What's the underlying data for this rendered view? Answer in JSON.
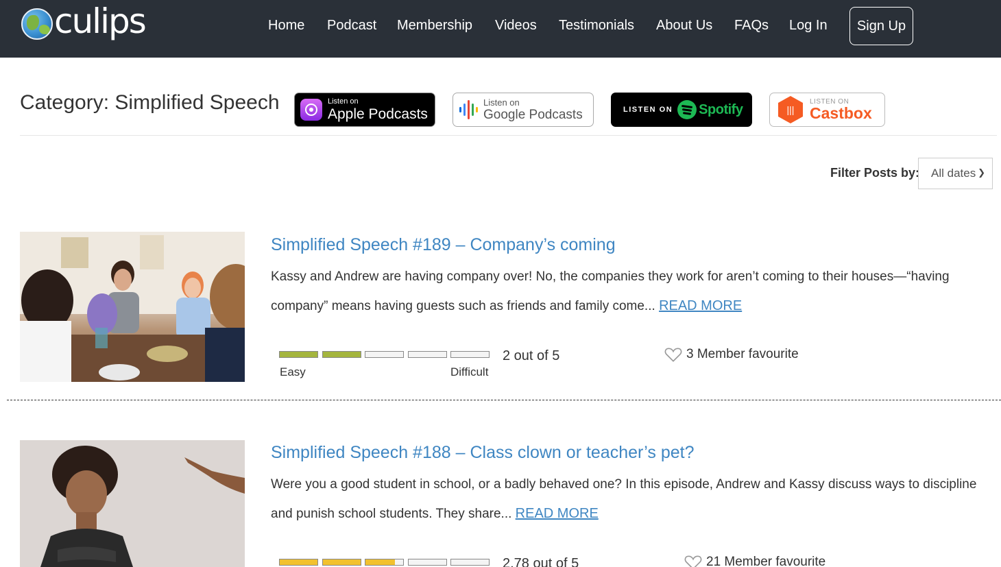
{
  "header": {
    "logo_text": "culips",
    "nav": [
      "Home",
      "Podcast",
      "Membership",
      "Videos",
      "Testimonials",
      "About Us",
      "FAQs",
      "Log In"
    ],
    "signup_label": "Sign Up"
  },
  "category": {
    "title": "Category: Simplified Speech"
  },
  "badges": {
    "apple": {
      "small": "Listen on",
      "big": "Apple Podcasts"
    },
    "google": {
      "small": "Listen on",
      "big": "Google Podcasts"
    },
    "spotify": {
      "small": "LISTEN ON",
      "big": "Spotify"
    },
    "castbox": {
      "small": "LISTEN ON",
      "big": "Castbox"
    }
  },
  "filter": {
    "label": "Filter Posts by:",
    "selected": "All dates"
  },
  "posts": [
    {
      "title": "Simplified Speech #189 – Company’s coming",
      "excerpt": "Kassy and Andrew are having company over! No, the companies they work for aren’t coming to their houses—“having company” means having guests such as friends and family come...",
      "read_more": "READ MORE",
      "difficulty": 2,
      "difficulty_text": "2 out of 5",
      "difficulty_color": "#a4b53e",
      "easy_label": "Easy",
      "difficult_label": "Difficult",
      "favourite_text": "3 Member favourite"
    },
    {
      "title": "Simplified Speech #188 – Class clown or teacher’s pet?",
      "excerpt": "Were you a good student in school, or a badly behaved one? In this episode, Andrew and Kassy discuss ways to discipline and punish school students. They share...",
      "read_more": "READ MORE",
      "difficulty": 2.78,
      "difficulty_text": "2.78 out of 5",
      "difficulty_color": "#f2c12e",
      "favourite_text": "21 Member favourite"
    }
  ],
  "colors": {
    "header_bg": "#2a3038",
    "link": "#3f86c2"
  }
}
